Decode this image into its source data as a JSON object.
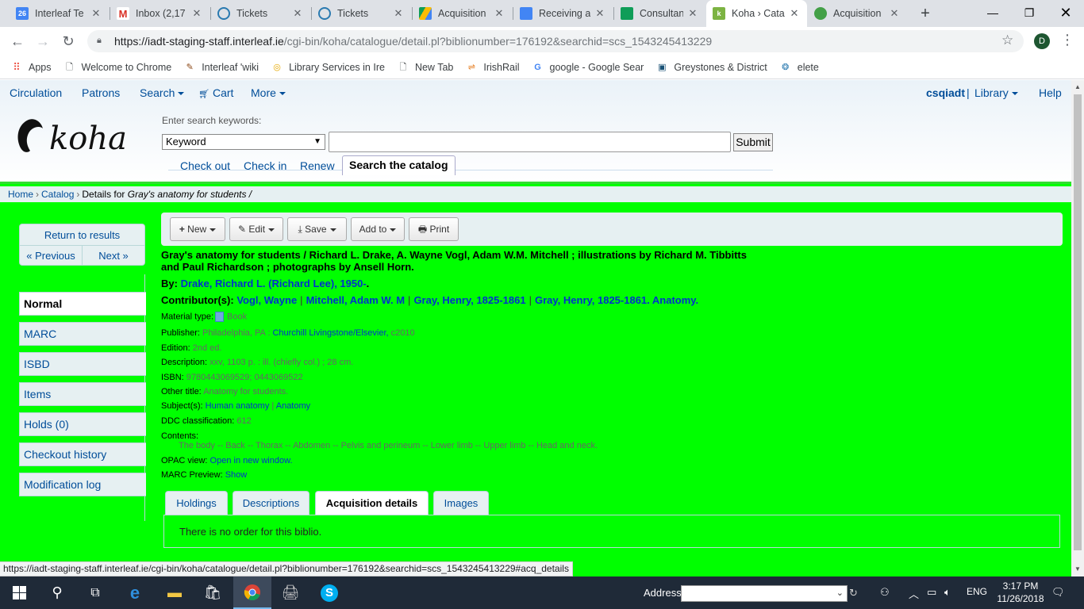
{
  "browser": {
    "tabs": [
      {
        "title": "Interleaf Te",
        "favicon": "calendar-icon",
        "color": "#4285f4",
        "badge": "26"
      },
      {
        "title": "Inbox (2,17",
        "favicon": "gmail-icon",
        "color": "#d93025",
        "badge": "M"
      },
      {
        "title": "Tickets",
        "favicon": "tickets-icon",
        "color": "#2a7ab0",
        "badge": ""
      },
      {
        "title": "Tickets",
        "favicon": "tickets-icon",
        "color": "#2a7ab0",
        "badge": ""
      },
      {
        "title": "Acquisition",
        "favicon": "drive-icon",
        "color": "#fbbc04",
        "badge": ""
      },
      {
        "title": "Receiving a",
        "favicon": "docs-icon",
        "color": "#4285f4",
        "badge": ""
      },
      {
        "title": "Consultancy",
        "favicon": "sheets-icon",
        "color": "#0f9d58",
        "badge": ""
      },
      {
        "title": "Koha › Cata",
        "favicon": "koha-icon",
        "color": "#7cb342",
        "badge": "k"
      },
      {
        "title": "Acquisition",
        "favicon": "koha-icon",
        "color": "#43a047",
        "badge": ""
      }
    ],
    "active_tab_index": 7,
    "url_host": "https://iadt-staging-staff.interleaf.ie",
    "url_path": "/cgi-bin/koha/catalogue/detail.pl?biblionumber=176192&searchid=scs_1543245413229",
    "profile_initial": "D",
    "bookmarks": [
      {
        "label": "Apps",
        "icon": "apps-grid-icon"
      },
      {
        "label": "Welcome to Chrome",
        "icon": "page-icon"
      },
      {
        "label": "Interleaf 'wiki",
        "icon": "wiki-icon"
      },
      {
        "label": "Library Services in Ire",
        "icon": "library-icon"
      },
      {
        "label": "New Tab",
        "icon": "page-icon"
      },
      {
        "label": "IrishRail",
        "icon": "rail-icon"
      },
      {
        "label": "google - Google Sear",
        "icon": "google-icon"
      },
      {
        "label": "Greystones & District",
        "icon": "greystones-icon"
      },
      {
        "label": "elete",
        "icon": "elete-icon"
      }
    ]
  },
  "koha": {
    "topnav": {
      "circulation": "Circulation",
      "patrons": "Patrons",
      "search": "Search",
      "cart": "Cart",
      "more": "More",
      "user": "csqiadt",
      "library": "Library",
      "help": "Help"
    },
    "search": {
      "label": "Enter search keywords:",
      "type_selected": "Keyword",
      "submit": "Submit"
    },
    "circ_tabs": {
      "checkout": "Check out",
      "checkin": "Check in",
      "renew": "Renew",
      "search_catalog": "Search the catalog"
    },
    "breadcrumb": {
      "home": "Home",
      "catalog": "Catalog",
      "details_prefix": "Details for",
      "details_title": "Gray's anatomy for students /"
    },
    "nav": {
      "return": "Return to results",
      "previous": "« Previous",
      "next": "Next »"
    },
    "left_menu": [
      {
        "label": "Normal",
        "selected": true
      },
      {
        "label": "MARC",
        "selected": false
      },
      {
        "label": "ISBD",
        "selected": false
      },
      {
        "label": "Items",
        "selected": false
      },
      {
        "label": "Holds (0)",
        "selected": false
      },
      {
        "label": "Checkout history",
        "selected": false
      },
      {
        "label": "Modification log",
        "selected": false
      }
    ],
    "toolbar": {
      "new": "New",
      "edit": "Edit",
      "save": "Save",
      "add_to": "Add to",
      "print": "Print"
    },
    "record": {
      "title": "Gray's anatomy for students / Richard L. Drake, A. Wayne Vogl, Adam W.M. Mitchell ; illustrations by Richard M. Tibbitts and Paul Richardson ; photographs by Ansell Horn.",
      "by_label": "By:",
      "author": "Drake, Richard L. (Richard Lee), 1950-",
      "author_suffix": ".",
      "contributors_label": "Contributor(s):",
      "contributors": [
        "Vogl, Wayne",
        "Mitchell, Adam W. M",
        "Gray, Henry, 1825-1861",
        "Gray, Henry, 1825-1861. Anatomy."
      ],
      "material_label": "Material type:",
      "material_value": "Book",
      "publisher_label": "Publisher:",
      "publisher_place": "Philadelphia, PA :",
      "publisher_name": "Churchill Livingstone/Elsevier,",
      "publisher_year": "c2010",
      "edition_label": "Edition:",
      "edition_value": "2nd ed.",
      "description_label": "Description:",
      "description_value": "xxv, 1103 p. : ill. (chiefly col.) ; 28 cm.",
      "isbn_label": "ISBN:",
      "isbn_value": "9780443069529; 0443069522",
      "other_title_label": "Other title:",
      "other_title_value": "Anatomy for students.",
      "subjects_label": "Subject(s):",
      "subject_1": "Human anatomy",
      "subject_sep": "|",
      "subject_2": "Anatomy",
      "ddc_label": "DDC classification:",
      "ddc_value": "612",
      "contents_label": "Contents:",
      "contents_value": "The body -- Back -- Thorax -- Abdomen -- Pelvis and perineum -- Lower limb -- Upper limb -- Head and neck.",
      "opac_label": "OPAC view:",
      "opac_value": "Open in new window.",
      "marc_label": "MARC Preview:",
      "marc_value": "Show"
    },
    "bottom_tabs": [
      "Holdings",
      "Descriptions",
      "Acquisition details",
      "Images"
    ],
    "active_bottom_tab": 2,
    "panel_text": "There is no order for this biblio."
  },
  "status_url": "https://iadt-staging-staff.interleaf.ie/cgi-bin/koha/catalogue/detail.pl?biblionumber=176192&searchid=scs_1543245413229#acq_details",
  "taskbar": {
    "address_label": "Address",
    "lang": "ENG",
    "time": "3:17 PM",
    "date": "11/26/2018"
  }
}
